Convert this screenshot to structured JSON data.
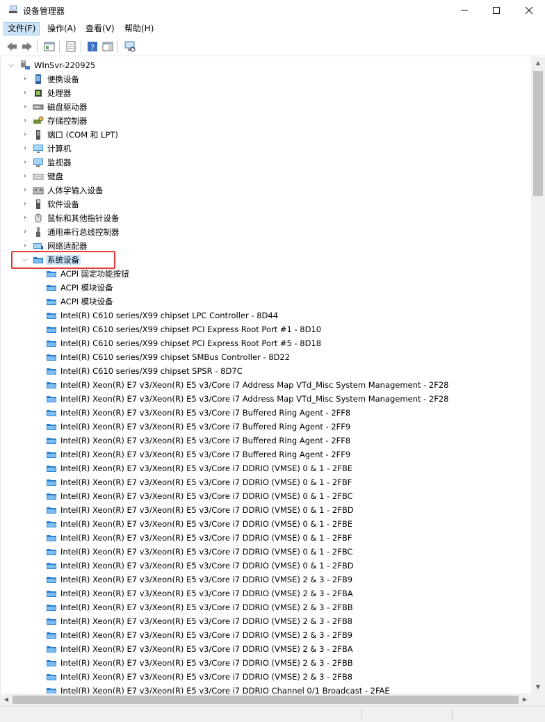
{
  "window": {
    "title": "设备管理器"
  },
  "menu": {
    "items": [
      "文件(F)",
      "操作(A)",
      "查看(V)",
      "帮助(H)"
    ]
  },
  "tree": {
    "root": "WInSvr-220925",
    "categories": [
      {
        "label": "便携设备",
        "icon": "portable-device-icon"
      },
      {
        "label": "处理器",
        "icon": "processor-icon"
      },
      {
        "label": "磁盘驱动器",
        "icon": "disk-drive-icon"
      },
      {
        "label": "存储控制器",
        "icon": "storage-controller-icon"
      },
      {
        "label": "端口 (COM 和 LPT)",
        "icon": "port-icon"
      },
      {
        "label": "计算机",
        "icon": "computer-icon"
      },
      {
        "label": "监视器",
        "icon": "monitor-icon"
      },
      {
        "label": "键盘",
        "icon": "keyboard-icon"
      },
      {
        "label": "人体学输入设备",
        "icon": "hid-icon"
      },
      {
        "label": "软件设备",
        "icon": "software-device-icon"
      },
      {
        "label": "鼠标和其他指针设备",
        "icon": "mouse-icon"
      },
      {
        "label": "通用串行总线控制器",
        "icon": "usb-icon"
      },
      {
        "label": "网络适配器",
        "icon": "network-adapter-icon"
      }
    ],
    "expanded": {
      "label": "系统设备",
      "children": [
        "ACPI 固定功能按钮",
        "ACPI 模块设备",
        "ACPI 模块设备",
        "Intel(R) C610 series/X99 chipset LPC Controller - 8D44",
        "Intel(R) C610 series/X99 chipset PCI Express Root Port #1 - 8D10",
        "Intel(R) C610 series/X99 chipset PCI Express Root Port #5 - 8D18",
        "Intel(R) C610 series/X99 chipset SMBus Controller - 8D22",
        "Intel(R) C610 series/X99 chipset SPSR - 8D7C",
        "Intel(R) Xeon(R) E7 v3/Xeon(R) E5 v3/Core i7 Address Map VTd_Misc System Management - 2F28",
        "Intel(R) Xeon(R) E7 v3/Xeon(R) E5 v3/Core i7 Address Map VTd_Misc System Management - 2F28",
        "Intel(R) Xeon(R) E7 v3/Xeon(R) E5 v3/Core i7 Buffered Ring Agent - 2FF8",
        "Intel(R) Xeon(R) E7 v3/Xeon(R) E5 v3/Core i7 Buffered Ring Agent - 2FF9",
        "Intel(R) Xeon(R) E7 v3/Xeon(R) E5 v3/Core i7 Buffered Ring Agent - 2FF8",
        "Intel(R) Xeon(R) E7 v3/Xeon(R) E5 v3/Core i7 Buffered Ring Agent - 2FF9",
        "Intel(R) Xeon(R) E7 v3/Xeon(R) E5 v3/Core i7 DDRIO (VMSE) 0 & 1 - 2FBE",
        "Intel(R) Xeon(R) E7 v3/Xeon(R) E5 v3/Core i7 DDRIO (VMSE) 0 & 1 - 2FBF",
        "Intel(R) Xeon(R) E7 v3/Xeon(R) E5 v3/Core i7 DDRIO (VMSE) 0 & 1 - 2FBC",
        "Intel(R) Xeon(R) E7 v3/Xeon(R) E5 v3/Core i7 DDRIO (VMSE) 0 & 1 - 2FBD",
        "Intel(R) Xeon(R) E7 v3/Xeon(R) E5 v3/Core i7 DDRIO (VMSE) 0 & 1 - 2FBE",
        "Intel(R) Xeon(R) E7 v3/Xeon(R) E5 v3/Core i7 DDRIO (VMSE) 0 & 1 - 2FBF",
        "Intel(R) Xeon(R) E7 v3/Xeon(R) E5 v3/Core i7 DDRIO (VMSE) 0 & 1 - 2FBC",
        "Intel(R) Xeon(R) E7 v3/Xeon(R) E5 v3/Core i7 DDRIO (VMSE) 0 & 1 - 2FBD",
        "Intel(R) Xeon(R) E7 v3/Xeon(R) E5 v3/Core i7 DDRIO (VMSE) 2 & 3 - 2FB9",
        "Intel(R) Xeon(R) E7 v3/Xeon(R) E5 v3/Core i7 DDRIO (VMSE) 2 & 3 - 2FBA",
        "Intel(R) Xeon(R) E7 v3/Xeon(R) E5 v3/Core i7 DDRIO (VMSE) 2 & 3 - 2FBB",
        "Intel(R) Xeon(R) E7 v3/Xeon(R) E5 v3/Core i7 DDRIO (VMSE) 2 & 3 - 2FB8",
        "Intel(R) Xeon(R) E7 v3/Xeon(R) E5 v3/Core i7 DDRIO (VMSE) 2 & 3 - 2FB9",
        "Intel(R) Xeon(R) E7 v3/Xeon(R) E5 v3/Core i7 DDRIO (VMSE) 2 & 3 - 2FBA",
        "Intel(R) Xeon(R) E7 v3/Xeon(R) E5 v3/Core i7 DDRIO (VMSE) 2 & 3 - 2FBB",
        "Intel(R) Xeon(R) E7 v3/Xeon(R) E5 v3/Core i7 DDRIO (VMSE) 2 & 3 - 2FB8",
        "Intel(R) Xeon(R) E7 v3/Xeon(R) E5 v3/Core i7 DDRIO Channel 0/1 Broadcast - 2FAE"
      ]
    }
  },
  "colors": {
    "selection": "#cce8ff",
    "highlight_border": "#e53935",
    "menu_active": "#cce4f7"
  }
}
